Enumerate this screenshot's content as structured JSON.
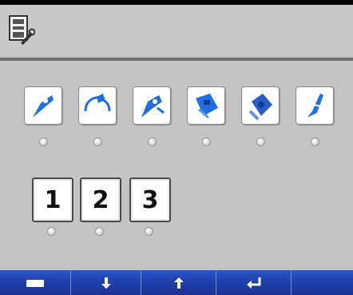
{
  "header": {
    "icon": "tool-settings-icon"
  },
  "tools": [
    {
      "icon": "probe-tool-icon",
      "selected": false
    },
    {
      "icon": "clamp-tool-icon",
      "selected": false
    },
    {
      "icon": "probe-tool-alt-icon",
      "selected": false
    },
    {
      "icon": "brush-head-icon",
      "selected": false
    },
    {
      "icon": "brush-head-alt-icon",
      "selected": false
    },
    {
      "icon": "pen-tool-icon",
      "selected": false
    }
  ],
  "numbers": [
    {
      "label": "1",
      "selected": false
    },
    {
      "label": "2",
      "selected": false
    },
    {
      "label": "3",
      "selected": false
    }
  ],
  "softkeys": [
    {
      "icon": "keyboard-icon"
    },
    {
      "icon": "arrow-down-icon"
    },
    {
      "icon": "arrow-up-icon"
    },
    {
      "icon": "enter-icon"
    },
    {
      "icon": "blank"
    }
  ],
  "colors": {
    "background": "#c4c4c4",
    "softkey_blue": "#1e3ea8",
    "icon_blue": "#1f6fe0"
  }
}
